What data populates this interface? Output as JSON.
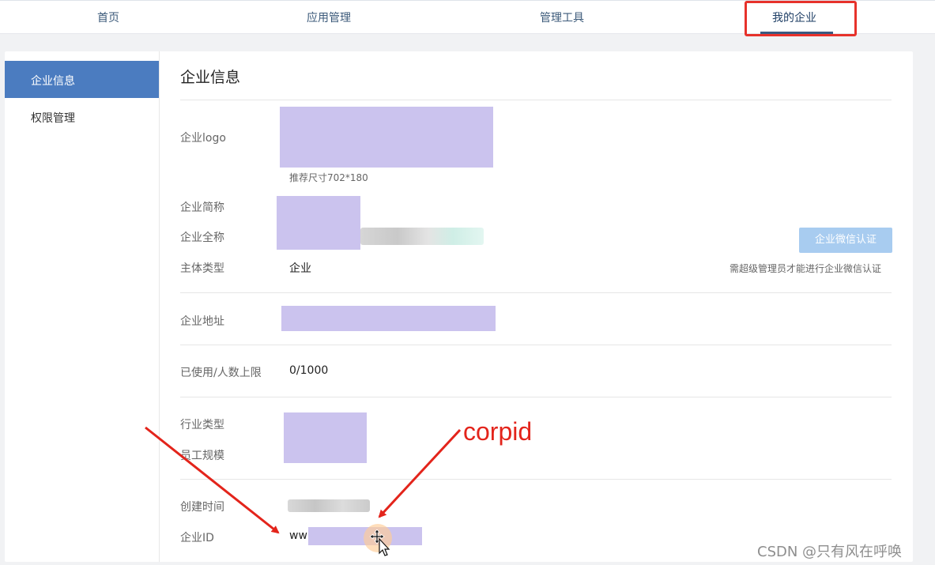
{
  "nav": {
    "items": [
      "首页",
      "应用管理",
      "管理工具",
      "我的企业"
    ],
    "active_index": 3
  },
  "sidebar": {
    "items": [
      {
        "label": "企业信息",
        "active": true
      },
      {
        "label": "权限管理",
        "active": false
      }
    ]
  },
  "main": {
    "title": "企业信息",
    "logo_label": "企业logo",
    "logo_hint": "推荐尺寸702*180",
    "short_name_label": "企业简称",
    "full_name_label": "企业全称",
    "entity_type_label": "主体类型",
    "entity_type_value": "企业",
    "verify_button": "企业微信认证",
    "verify_hint": "需超级管理员才能进行企业微信认证",
    "address_label": "企业地址",
    "usage_label": "已使用/人数上限",
    "usage_value": "0/1000",
    "industry_label": "行业类型",
    "staff_size_label": "员工规模",
    "created_label": "创建时间",
    "corp_id_label": "企业ID",
    "corp_id_prefix": "ww"
  },
  "annotation": {
    "text": "corpid",
    "color": "#e3241b"
  },
  "watermark": "CSDN @只有风在呼唤",
  "colors": {
    "active_sidebar": "#4b7cc0",
    "verify_button": "#a8ccf0",
    "redaction_mask": "#cbc3ee",
    "highlight": "#e7322b"
  },
  "icons": [
    "move-cursor-icon"
  ]
}
